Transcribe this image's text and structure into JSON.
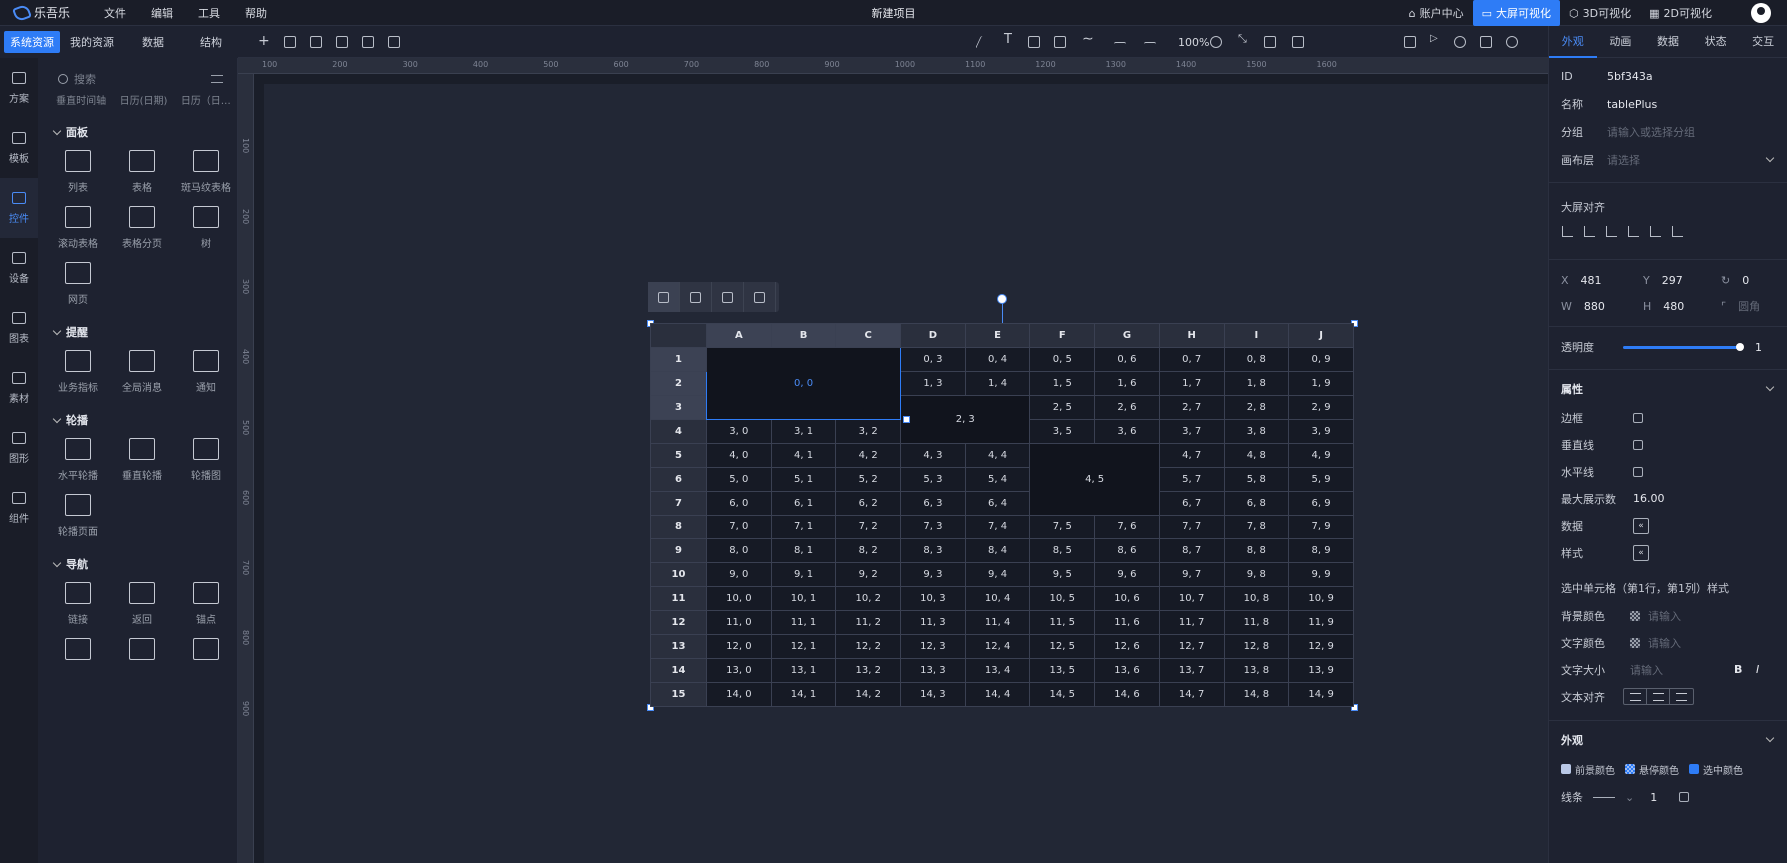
{
  "app": {
    "brand": "乐吾乐",
    "project_title": "新建项目"
  },
  "menu": [
    "文件",
    "编辑",
    "工具",
    "帮助"
  ],
  "topnav": [
    {
      "label": "账户中心",
      "icon": "home-icon",
      "active": false
    },
    {
      "label": "大屏可视化",
      "icon": "monitor-icon",
      "active": true
    },
    {
      "label": "3D可视化",
      "icon": "cube-icon",
      "active": false
    },
    {
      "label": "2D可视化",
      "icon": "grid-icon",
      "active": false
    }
  ],
  "left_tabs": [
    {
      "label": "系统资源",
      "active": true
    },
    {
      "label": "我的资源",
      "active": false
    },
    {
      "label": "数据",
      "active": false
    },
    {
      "label": "结构",
      "active": false
    }
  ],
  "rail": [
    {
      "label": "方案",
      "icon": "monitor-icon",
      "active": false
    },
    {
      "label": "模板",
      "icon": "template-icon",
      "active": false
    },
    {
      "label": "控件",
      "icon": "widget-icon",
      "active": true
    },
    {
      "label": "设备",
      "icon": "device-icon",
      "active": false
    },
    {
      "label": "图表",
      "icon": "chart-icon",
      "active": false
    },
    {
      "label": "素材",
      "icon": "image-icon",
      "active": false
    },
    {
      "label": "图形",
      "icon": "shape-icon",
      "active": false
    },
    {
      "label": "组件",
      "icon": "component-icon",
      "active": false
    }
  ],
  "search": {
    "placeholder": "搜索"
  },
  "cut_row": [
    "垂直时间轴",
    "日历(日期)",
    "日历（日…"
  ],
  "categories": [
    {
      "title": "面板",
      "items": [
        "列表",
        "表格",
        "斑马纹表格",
        "滚动表格",
        "表格分页",
        "树",
        "网页"
      ]
    },
    {
      "title": "提醒",
      "items": [
        "业务指标",
        "全局消息",
        "通知"
      ]
    },
    {
      "title": "轮播",
      "items": [
        "水平轮播",
        "垂直轮播",
        "轮播图",
        "轮播页面"
      ]
    },
    {
      "title": "导航",
      "items": [
        "链接",
        "返回",
        "锚点",
        "",
        "",
        ""
      ]
    }
  ],
  "toolbar": {
    "zoom": "100%"
  },
  "ruler": {
    "h": [
      "100",
      "200",
      "300",
      "400",
      "500",
      "600",
      "700",
      "800",
      "900",
      "1000",
      "1100",
      "1200",
      "1300",
      "1400",
      "1500",
      "1600"
    ],
    "v": [
      "0",
      "100",
      "200",
      "300",
      "400",
      "500",
      "600",
      "700",
      "800",
      "900"
    ]
  },
  "table": {
    "columns": [
      "A",
      "B",
      "C",
      "D",
      "E",
      "F",
      "G",
      "H",
      "I",
      "J"
    ],
    "rows": [
      "1",
      "2",
      "3",
      "4",
      "5",
      "6",
      "7",
      "8",
      "9",
      "10",
      "11",
      "12",
      "13",
      "14",
      "15"
    ],
    "merged": [
      {
        "row": 0,
        "col": 0,
        "rowspan": 3,
        "colspan": 3,
        "text": "0, 0",
        "selected": true
      },
      {
        "row": 2,
        "col": 3,
        "rowspan": 2,
        "colspan": 2,
        "text": "2, 3",
        "selected": false
      },
      {
        "row": 4,
        "col": 5,
        "rowspan": 3,
        "colspan": 2,
        "text": "4, 5",
        "selected": false
      }
    ]
  },
  "right_tabs": [
    {
      "label": "外观",
      "active": true
    },
    {
      "label": "动画",
      "active": false
    },
    {
      "label": "数据",
      "active": false
    },
    {
      "label": "状态",
      "active": false
    },
    {
      "label": "交互",
      "active": false
    }
  ],
  "props": {
    "id_label": "ID",
    "id_value": "5bf343a",
    "name_label": "名称",
    "name_value": "tablePlus",
    "group_label": "分组",
    "group_placeholder": "请输入或选择分组",
    "layer_label": "画布层",
    "layer_placeholder": "请选择",
    "screen_align": "大屏对齐",
    "x_label": "X",
    "x": "481",
    "y_label": "Y",
    "y": "297",
    "rotate": "0",
    "w_label": "W",
    "w": "880",
    "h_label": "H",
    "h": "480",
    "radius_label": "圆角",
    "opacity_label": "透明度",
    "opacity": "1",
    "opacity_fraction": 1.0
  },
  "attrs": {
    "title": "属性",
    "border": "边框",
    "vline": "垂直线",
    "hline": "水平线",
    "max_rows_label": "最大展示数",
    "max_rows": "16.00",
    "data": "数据",
    "style": "样式",
    "selected_cell": "选中单元格（第1行，第1列）样式",
    "bg_color": "背景颜色",
    "text_color": "文字颜色",
    "font_size": "文字大小",
    "text_align": "文本对齐",
    "input_placeholder": "请输入",
    "bold": "B",
    "italic": "I"
  },
  "appearance": {
    "title": "外观",
    "legend": [
      {
        "label": "前景颜色",
        "color": "#b9c8e6"
      },
      {
        "label": "悬停颜色",
        "color": "pattern"
      },
      {
        "label": "选中颜色",
        "color": "#2e7cf6"
      }
    ],
    "line_label": "线条",
    "line_width": "1"
  }
}
